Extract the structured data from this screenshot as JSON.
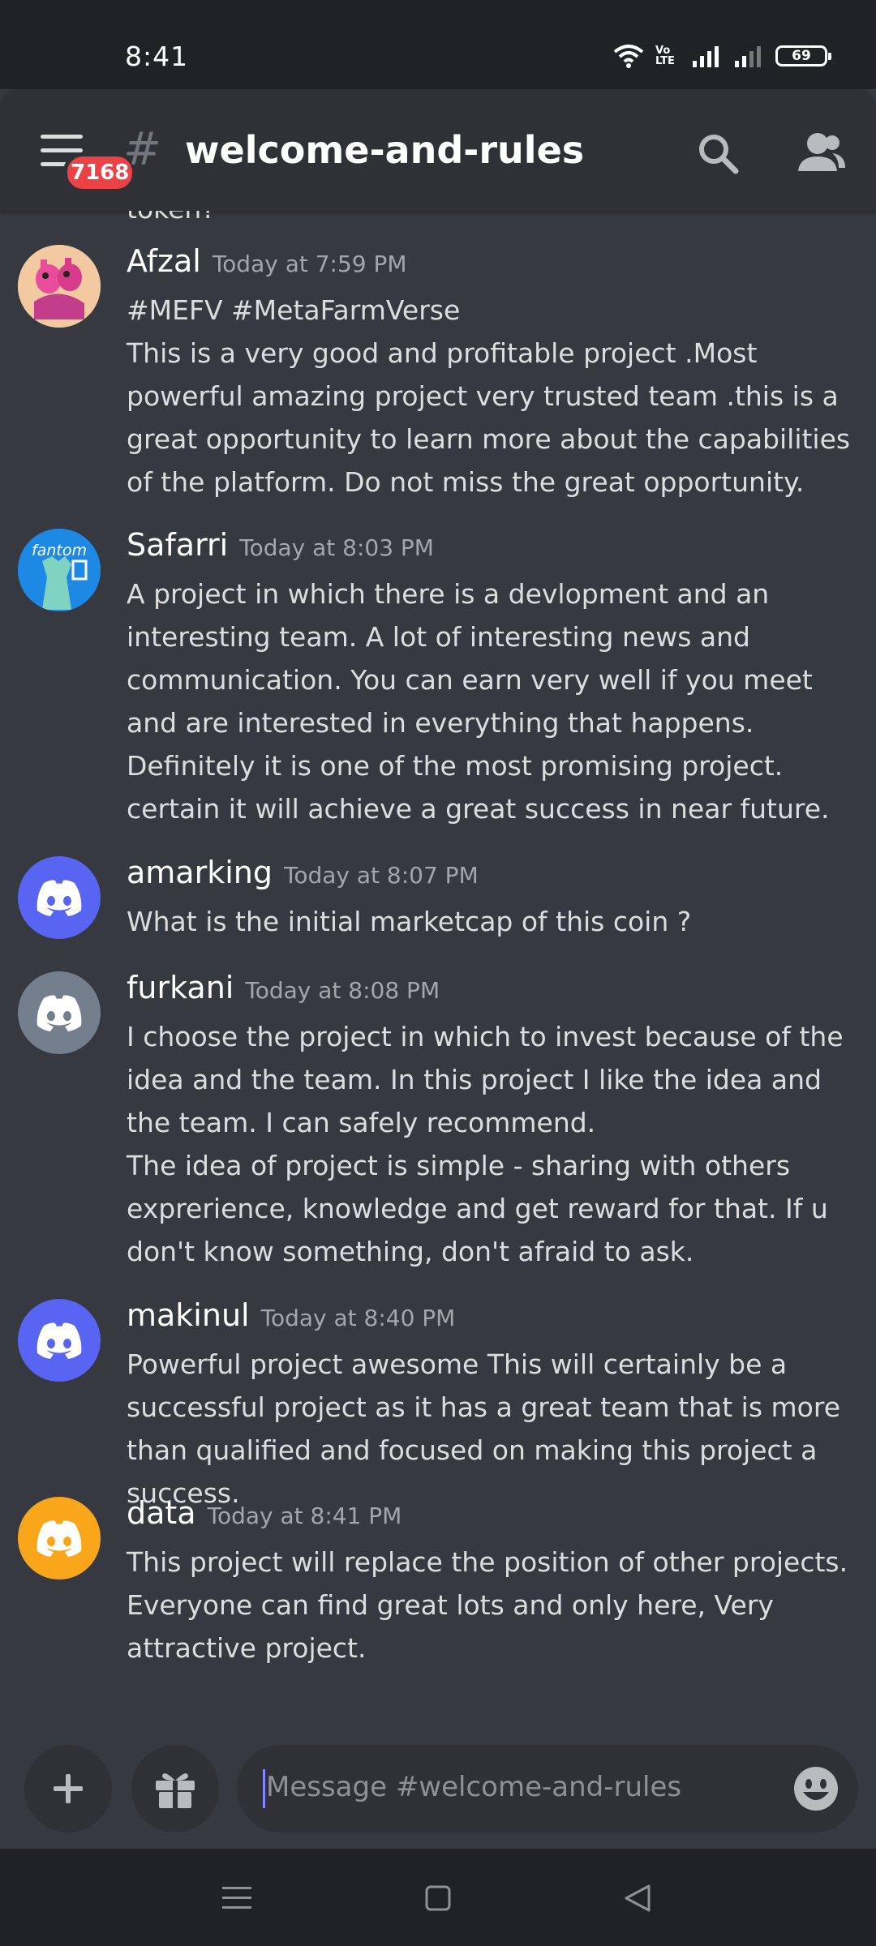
{
  "status_bar": {
    "time": "8:41",
    "network_label": "Vo LTE",
    "battery": "69"
  },
  "header": {
    "unread_badge": "7168",
    "hash_symbol": "#",
    "channel_name": "welcome-and-rules"
  },
  "cut_off_text": "token?",
  "messages": [
    {
      "author": "Afzal",
      "timestamp": "Today at 7:59 PM",
      "body": [
        "#MEFV #MetaFarmVerse",
        "This is a very good and profitable project .Most powerful amazing project very trusted team .this is a great opportunity to learn more about the capabilities of the platform. Do not miss the great opportunity."
      ]
    },
    {
      "author": "Safarri",
      "timestamp": "Today at 8:03 PM",
      "avatar_text": "fantom",
      "body": [
        "A project in which there is a devlopment and an interesting team. A lot of interesting news and communication. You can earn very well if you meet and are interested in everything that happens.",
        "Definitely it is one of the most promising project. certain it will achieve a great success in near future."
      ]
    },
    {
      "author": "amarking",
      "timestamp": "Today at 8:07 PM",
      "body": [
        "What is the initial marketcap of this coin ?"
      ]
    },
    {
      "author": "furkani",
      "timestamp": "Today at 8:08 PM",
      "body": [
        "I choose the project in which to invest because of the idea and the team. In this project I like the idea and the team. I can safely recommend.",
        "The idea of project is simple - sharing with others exprerience, knowledge and get reward for that. If u don't know something, don't afraid to ask."
      ]
    },
    {
      "author": "makinul",
      "timestamp": "Today at 8:40 PM",
      "body": [
        "Powerful project awesome This will certainly be a successful project as it has a great team that is more than qualified and focused on making this project a success."
      ]
    },
    {
      "author": "data",
      "timestamp": "Today at 8:41 PM",
      "body": [
        "This project will replace the position of other projects. Everyone can find great lots and only here, Very attractive project."
      ]
    }
  ],
  "composer": {
    "placeholder": "Message #welcome-and-rules"
  },
  "colors": {
    "background": "#36393f",
    "header": "#2f3136",
    "blurple_avatar": "#5865f2",
    "grey_avatar": "#747f8d",
    "orange_avatar": "#faa61a",
    "badge": "#ed4245"
  },
  "icons": {
    "menu": "hamburger-icon",
    "search": "search-icon",
    "members": "members-icon",
    "add": "plus-icon",
    "gift": "gift-icon",
    "emoji": "emoji-icon",
    "discord_default_avatar": "discord-logo-icon"
  }
}
